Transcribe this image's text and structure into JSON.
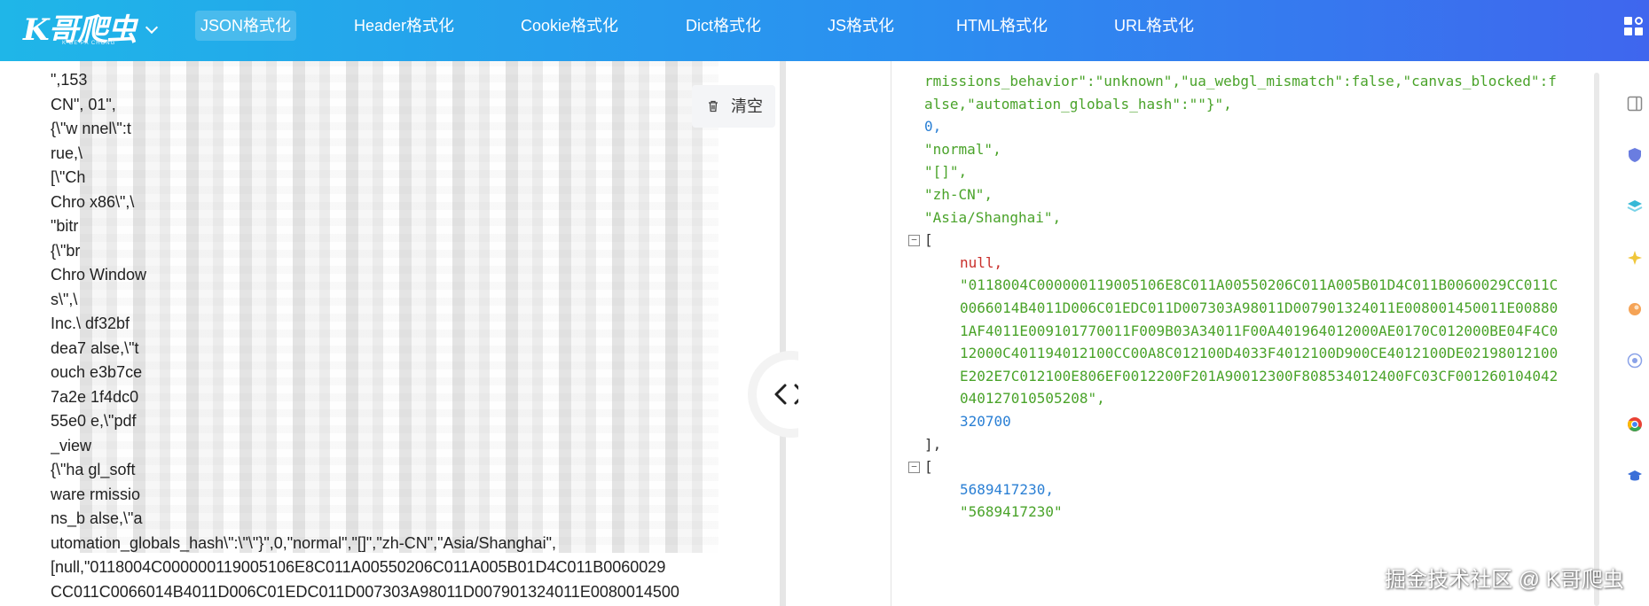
{
  "header": {
    "logo_text": "K哥爬虫",
    "logo_subtitle": "K GE PA CHONG",
    "nav": [
      {
        "label": "JSON格式化",
        "active": true
      },
      {
        "label": "Header格式化",
        "active": false
      },
      {
        "label": "Cookie格式化",
        "active": false
      },
      {
        "label": "Dict格式化",
        "active": false
      },
      {
        "label": "JS格式化",
        "active": false
      },
      {
        "label": "HTML格式化",
        "active": false
      },
      {
        "label": "URL格式化",
        "active": false
      }
    ]
  },
  "editor": {
    "clear_label": "清空",
    "lines": [
      "\",153",
      "CN\",                                                                    01\",",
      "{\\\"w                                                                  nnel\\\":t",
      "rue,\\",
      "[\\\"Ch",
      "Chro                                                                 x86\\\",\\",
      "\"bitr",
      "{\\\"br",
      "Chro                                                               Window",
      "s\\\",\\",
      "Inc.\\                                                                 df32bf",
      "dea7                                                                 alse,\\\"t",
      "ouch                                                                 e3b7ce",
      "7a2e                                                                  1f4dc0",
      "55e0                                                                 e,\\\"pdf",
      "_view",
      "{\\\"ha                                                                 gl_soft",
      "ware                                                                  rmissio",
      "ns_b                                                                  alse,\\\"a",
      "utomation_globals_hash\\\":\\\"\\\"}\",0,\"normal\",\"[]\",\"zh-CN\",\"Asia/Shanghai\",",
      "[null,\"0118004C000000119005106E8C011A00550206C011A005B01D4C011B0060029",
      "CC011C0066014B4011D006C01EDC011D007303A98011D007901324011E0080014500"
    ]
  },
  "formatted": {
    "lines": [
      {
        "text": "rmissions_behavior\":\"unknown\",\"ua_webgl_mismatch\":false,\"canvas_blocked\":f",
        "kind": "str",
        "indent": 0
      },
      {
        "text": "alse,\"automation_globals_hash\":\"\"}\",",
        "kind": "str",
        "indent": 0
      },
      {
        "text": "0,",
        "kind": "num",
        "indent": 0
      },
      {
        "text": "\"normal\",",
        "kind": "str",
        "indent": 0
      },
      {
        "text": "\"[]\",",
        "kind": "str",
        "indent": 0
      },
      {
        "text": "\"zh-CN\",",
        "kind": "str",
        "indent": 0
      },
      {
        "text": "\"Asia/Shanghai\",",
        "kind": "str",
        "indent": 0
      },
      {
        "text": "[",
        "kind": "pun",
        "indent": 0,
        "fold": true
      },
      {
        "text": "null,",
        "kind": "nul",
        "indent": 1
      },
      {
        "text": "\"0118004C000000119005106E8C011A00550206C011A005B01D4C011B0060029CC011C",
        "kind": "str",
        "indent": 1
      },
      {
        "text": "0066014B4011D006C01EDC011D007303A98011D007901324011E008001450011E00880",
        "kind": "str",
        "indent": 1
      },
      {
        "text": "1AF4011E009101770011F009B03A34011F00A401964012000AE0170C012000BE04F4C0",
        "kind": "str",
        "indent": 1
      },
      {
        "text": "12000C401194012100CC00A8C012100D4033F4012100D900CE4012100DE02198012100",
        "kind": "str",
        "indent": 1
      },
      {
        "text": "E202E7C012100E806EF0012200F201A90012300F808534012400FC03CF001260104042",
        "kind": "str",
        "indent": 1
      },
      {
        "text": "040127010505208\",",
        "kind": "str",
        "indent": 1
      },
      {
        "text": "320700",
        "kind": "num",
        "indent": 1
      },
      {
        "text": "],",
        "kind": "pun",
        "indent": 0
      },
      {
        "text": "[",
        "kind": "pun",
        "indent": 0,
        "fold": true
      },
      {
        "text": "5689417230,",
        "kind": "num",
        "indent": 1
      },
      {
        "text": "\"5689417230\"",
        "kind": "str",
        "indent": 1
      }
    ]
  },
  "sidebar_icons": [
    "panel-icon",
    "shield-icon",
    "layers-icon",
    "spark-icon",
    "orange-circle-icon",
    "target-icon",
    "chrome-icon",
    "graduation-cap-icon"
  ],
  "watermark": "掘金技术社区 @ K哥爬虫",
  "colors": {
    "string": "#4aa32a",
    "number": "#2a7fd4",
    "null": "#c9302c",
    "header_start": "#1fb6e8",
    "header_end": "#3f66ee"
  }
}
